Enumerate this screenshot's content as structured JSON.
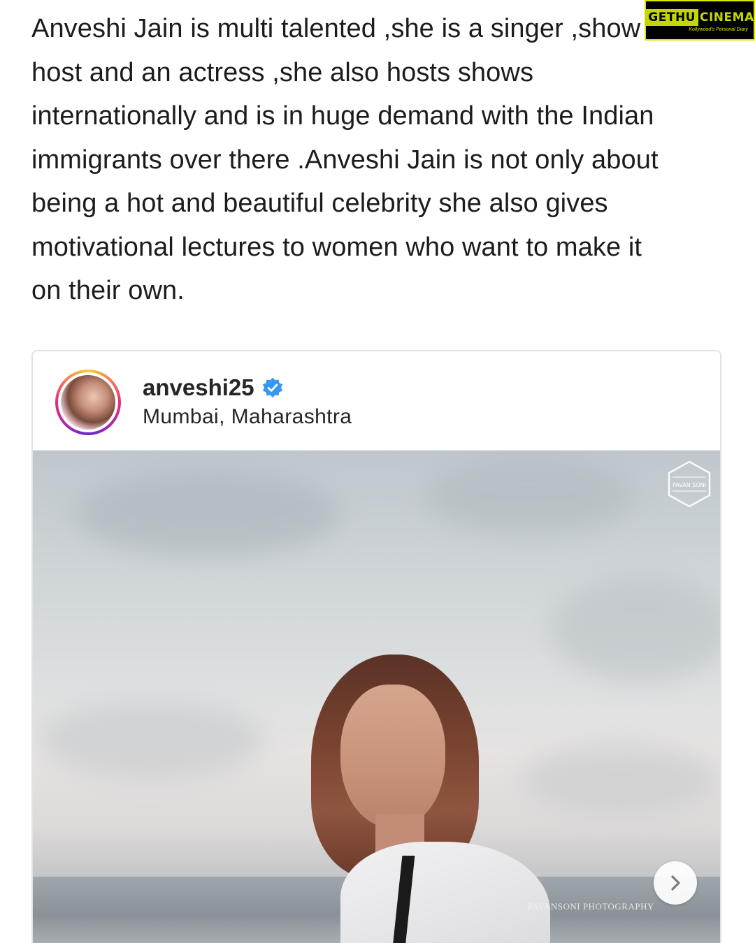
{
  "article": {
    "lines": [
      "Anveshi Jain is multi talented ,she is a singer ,show",
      "host and an actress ,she also hosts shows",
      "internationally and is in huge demand with the Indian",
      "immigrants over there .Anveshi Jain is not only about",
      "being a hot and beautiful celebrity she also gives",
      "motivational lectures to women who want to make it",
      "on their own."
    ]
  },
  "watermark": {
    "left": "GETHU",
    "right": "CINEMA",
    "tagline": "Kollywood's Personal Diary",
    "colors": {
      "accent": "#c4d600",
      "background": "#000000"
    }
  },
  "post": {
    "username": "anveshi25",
    "verified": true,
    "location": "Mumbai, Maharashtra",
    "photo_logo": "PAVAN SONI",
    "photo_credit": "PAVANSONI PHOTOGRAPHY",
    "icons": {
      "verified": "verified-badge-icon",
      "next": "chevron-right-icon"
    },
    "colors": {
      "verified": "#3897f0"
    }
  }
}
